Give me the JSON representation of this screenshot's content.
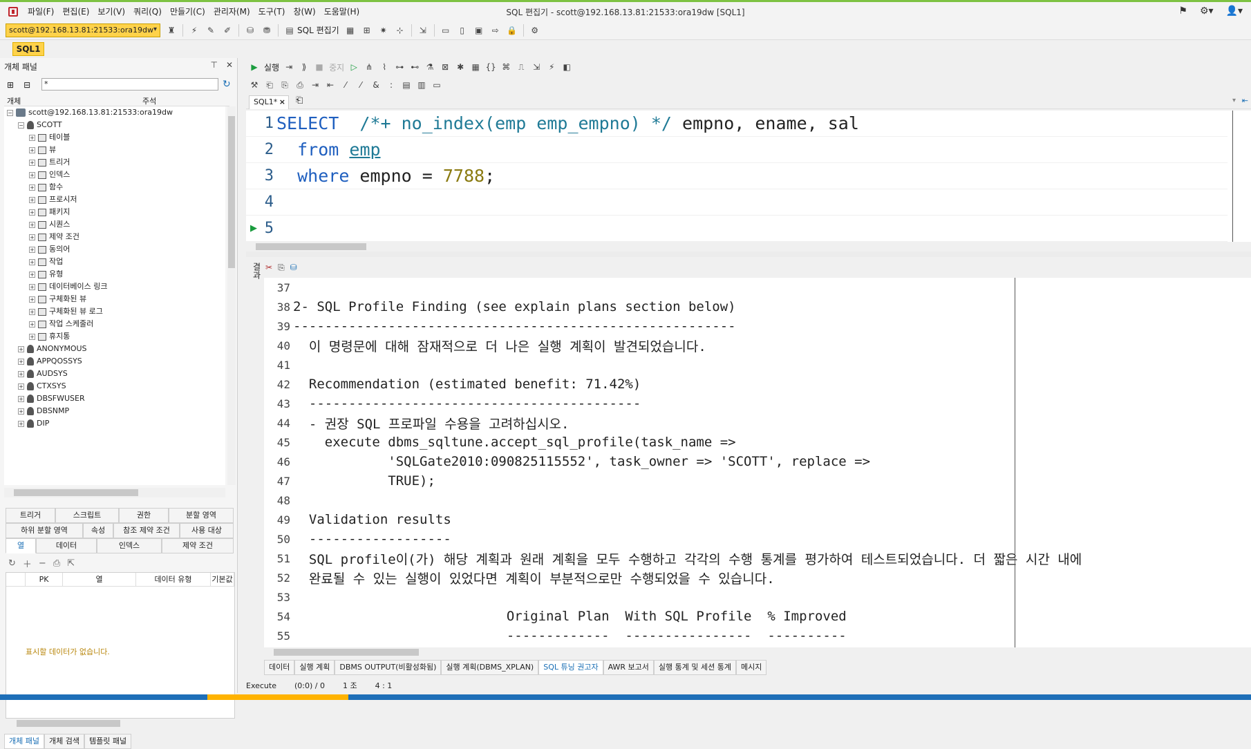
{
  "window": {
    "title": "SQL 편집기 - scott@192.168.13.81:21533:ora19dw [SQL1]"
  },
  "menu": [
    "파일(F)",
    "편집(E)",
    "보기(V)",
    "쿼리(Q)",
    "만들기(C)",
    "관리자(M)",
    "도구(T)",
    "창(W)",
    "도움말(H)"
  ],
  "toolbar": {
    "connection": "scott@192.168.13.81:21533:ora19dw",
    "sql_editor_label": "SQL 편집기"
  },
  "doc_tab": "SQL1",
  "left_panel": {
    "title": "개체 패널",
    "filter_value": "*",
    "col_object": "개체",
    "col_comment": "주석",
    "root": "scott@192.168.13.81:21533:ora19dw",
    "schema": "SCOTT",
    "children": [
      "테이블",
      "뷰",
      "트리거",
      "인덱스",
      "함수",
      "프로시저",
      "패키지",
      "시퀀스",
      "제약 조건",
      "동의어",
      "작업",
      "유형",
      "데이터베이스 링크",
      "구체화된 뷰",
      "구체화된 뷰 로그",
      "작업 스케줄러",
      "휴지통"
    ],
    "schemas": [
      "ANONYMOUS",
      "APPQOSSYS",
      "AUDSYS",
      "CTXSYS",
      "DBSFWUSER",
      "DBSNMP",
      "DIP"
    ],
    "prop_tabs_row1": [
      "트리거",
      "스크립트",
      "권한",
      "분할 영역"
    ],
    "prop_tabs_row2": [
      "하위 분할 영역",
      "속성",
      "참조 제약 조건",
      "사용 대상"
    ],
    "prop_tabs_row3": [
      "열",
      "데이터",
      "인덱스",
      "제약 조건"
    ],
    "grid_columns": [
      "PK",
      "열",
      "데이터 유형",
      "기본값"
    ],
    "no_data": "표시할 데이터가 없습니다.",
    "bottom_tabs": [
      "개체 패널",
      "개체 검색",
      "템플릿 패널"
    ]
  },
  "editor_toolbar": {
    "run": "실행",
    "stop": "중지"
  },
  "sql_tab": "SQL1*",
  "editor": {
    "line_numbers": [
      "1",
      "2",
      "3",
      "4",
      "5"
    ]
  },
  "results": {
    "side_label": "결과",
    "tabs": [
      "데이터",
      "실행 계획",
      "DBMS OUTPUT(비활성화됨)",
      "실행 계획(DBMS_XPLAN)",
      "SQL 튜닝 권고자",
      "AWR 보고서",
      "실행 통계 및 세션 통계",
      "메시지"
    ],
    "active_tab": "SQL 튜닝 권고자",
    "lines": [
      {
        "n": "37",
        "t": ""
      },
      {
        "n": "38",
        "t": "2- SQL Profile Finding (see explain plans section below)"
      },
      {
        "n": "39",
        "t": "--------------------------------------------------------"
      },
      {
        "n": "40",
        "t": "  이 명령문에 대해 잠재적으로 더 나은 실행 계획이 발견되었습니다."
      },
      {
        "n": "41",
        "t": ""
      },
      {
        "n": "42",
        "t": "  Recommendation (estimated benefit: 71.42%)"
      },
      {
        "n": "43",
        "t": "  ------------------------------------------"
      },
      {
        "n": "44",
        "t": "  - 권장 SQL 프로파일 수용을 고려하십시오."
      },
      {
        "n": "45",
        "t": "    execute dbms_sqltune.accept_sql_profile(task_name =>"
      },
      {
        "n": "46",
        "t": "            'SQLGate2010:090825115552', task_owner => 'SCOTT', replace =>"
      },
      {
        "n": "47",
        "t": "            TRUE);"
      },
      {
        "n": "48",
        "t": ""
      },
      {
        "n": "49",
        "t": "  Validation results"
      },
      {
        "n": "50",
        "t": "  ------------------"
      },
      {
        "n": "51",
        "t": "  SQL profile이(가) 해당 계획과 원래 계획을 모두 수행하고 각각의 수행 통계를 평가하여 테스트되었습니다. 더 짧은 시간 내에"
      },
      {
        "n": "52",
        "t": "  완료될 수 있는 실행이 있었다면 계획이 부분적으로만 수행되었을 수 있습니다."
      },
      {
        "n": "53",
        "t": ""
      },
      {
        "n": "54",
        "t": "                           Original Plan  With SQL Profile  % Improved"
      },
      {
        "n": "55",
        "t": "                           -------------  ----------------  ----------"
      }
    ]
  },
  "status": {
    "state": "Execute",
    "position": "(0:0) / 0",
    "count": "1 조",
    "cursor": "4 : 1"
  }
}
